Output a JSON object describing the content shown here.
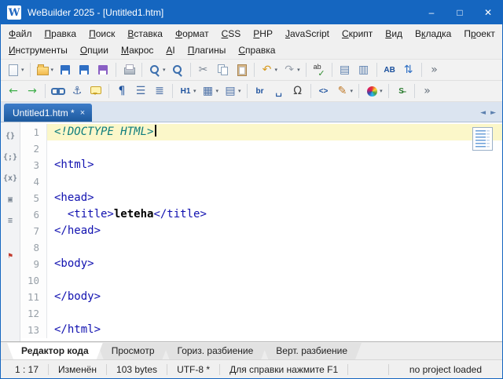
{
  "colors": {
    "titlebar": "#1566c0",
    "line_active": "#fbf7c9",
    "tag": "#1111b0",
    "doctype": "#0e7d7d"
  },
  "window": {
    "logo_letter": "W",
    "title": "WeBuilder 2025 - [Untitled1.htm]",
    "controls": {
      "minimize": "–",
      "maximize": "□",
      "close": "✕"
    }
  },
  "menu": {
    "row1": [
      {
        "label": "Файл",
        "accel": 0
      },
      {
        "label": "Правка",
        "accel": 0
      },
      {
        "label": "Поиск",
        "accel": 0
      },
      {
        "label": "Вставка",
        "accel": 0
      },
      {
        "label": "Формат",
        "accel": 0
      },
      {
        "label": "CSS",
        "accel": 0
      },
      {
        "label": "PHP",
        "accel": 0
      },
      {
        "label": "JavaScript",
        "accel": 0
      },
      {
        "label": "Скрипт",
        "accel": 0
      },
      {
        "label": "Вид",
        "accel": 0
      },
      {
        "label": "Вкладка",
        "accel": 1
      },
      {
        "label": "Проект",
        "accel": 1
      }
    ],
    "row2": [
      {
        "label": "Инструменты",
        "accel": 0
      },
      {
        "label": "Опции",
        "accel": 0
      },
      {
        "label": "Макрос",
        "accel": 0
      },
      {
        "label": "AI",
        "accel": 0
      },
      {
        "label": "Плагины",
        "accel": 0
      },
      {
        "label": "Справка",
        "accel": 0
      }
    ]
  },
  "toolbar": {
    "row1": [
      {
        "name": "new-file",
        "css": "file",
        "menu": true
      },
      {
        "sep": true
      },
      {
        "name": "open-file",
        "css": "folder",
        "menu": true
      },
      {
        "name": "save",
        "css": "save",
        "color": "#2f6fc4"
      },
      {
        "name": "save-all",
        "css": "save",
        "color": "#2f6fc4"
      },
      {
        "name": "save-as",
        "css": "save",
        "color": "#8a5fc4"
      },
      {
        "sep": true
      },
      {
        "name": "print",
        "css": "print"
      },
      {
        "sep": true
      },
      {
        "name": "find",
        "css": "search",
        "menu": true
      },
      {
        "name": "find-in-files",
        "css": "search"
      },
      {
        "sep": true
      },
      {
        "name": "cut",
        "glyph": "✂",
        "color": "#7a8694"
      },
      {
        "name": "copy",
        "css": "copy"
      },
      {
        "name": "paste",
        "css": "paste"
      },
      {
        "sep": true
      },
      {
        "name": "undo",
        "glyph": "↶",
        "color": "#d79a1e",
        "menu": true
      },
      {
        "name": "redo",
        "glyph": "↷",
        "color": "#9aa2ad",
        "menu": true
      },
      {
        "sep": true
      },
      {
        "name": "spell-check",
        "css": "spell"
      },
      {
        "sep": true
      },
      {
        "name": "code-explorer",
        "glyph": "▤",
        "color": "#5b7fae"
      },
      {
        "name": "split-view",
        "glyph": "▥",
        "color": "#5b7fae"
      },
      {
        "sep": true
      },
      {
        "name": "character-case",
        "text": "AB",
        "color": "#1a4f9c"
      },
      {
        "name": "sort-lines",
        "glyph": "⇅",
        "color": "#2f6fc4"
      },
      {
        "sep": true
      },
      {
        "name": "toolbar-overflow",
        "glyph": "»",
        "color": "#66707c"
      }
    ],
    "row2": [
      {
        "name": "navigate-back",
        "glyph": "←",
        "color": "#3fae4a"
      },
      {
        "name": "navigate-forward",
        "glyph": "→",
        "color": "#3fae4a"
      },
      {
        "sep": true
      },
      {
        "name": "hyperlink",
        "css": "link"
      },
      {
        "name": "anchor",
        "glyph": "⚓",
        "color": "#4a6fa5"
      },
      {
        "name": "comment",
        "css": "comment"
      },
      {
        "sep": true
      },
      {
        "name": "paragraph",
        "glyph": "¶",
        "color": "#1a4f9c"
      },
      {
        "name": "bullet-list",
        "glyph": "☰",
        "color": "#4a6fa5"
      },
      {
        "name": "numbered-list",
        "glyph": "≣",
        "color": "#4a6fa5"
      },
      {
        "sep": true
      },
      {
        "name": "heading",
        "text": "H1",
        "color": "#1a4f9c",
        "menu": true
      },
      {
        "name": "table",
        "glyph": "▦",
        "color": "#4a6fa5",
        "menu": true
      },
      {
        "name": "div-block",
        "glyph": "▤",
        "color": "#4a6fa5",
        "menu": true
      },
      {
        "sep": true
      },
      {
        "name": "line-break",
        "text": "br",
        "color": "#1a4f9c"
      },
      {
        "name": "non-breaking-space",
        "glyph": "␣",
        "color": "#1a4f9c"
      },
      {
        "name": "special-character",
        "glyph": "Ω",
        "color": "#444444"
      },
      {
        "sep": true
      },
      {
        "name": "insert-tag",
        "text": "<>",
        "color": "#1a4f9c"
      },
      {
        "name": "highlighter",
        "glyph": "✎",
        "color": "#c07a2a",
        "menu": true
      },
      {
        "sep": true
      },
      {
        "name": "color-picker",
        "css": "colorwheel",
        "menu": true
      },
      {
        "sep": true
      },
      {
        "name": "style-tool",
        "text": "S̶",
        "color": "#2e7d32"
      },
      {
        "sep": true
      },
      {
        "name": "toolbar-overflow",
        "glyph": "»",
        "color": "#66707c"
      }
    ]
  },
  "tabstrip": {
    "tabs": [
      {
        "label": "Untitled1.htm *",
        "close": "×",
        "active": true
      }
    ],
    "scroll_left": "◄",
    "scroll_right": "►"
  },
  "sidebar": {
    "icons": [
      {
        "name": "panel-code-snippets",
        "text": "{}"
      },
      {
        "name": "panel-code-inspector",
        "text": "{;}"
      },
      {
        "name": "panel-code-clips",
        "text": "{x}"
      },
      {
        "name": "panel-clipboard",
        "text": "▣"
      },
      {
        "name": "panel-file-explorer",
        "text": "≡"
      },
      {
        "name": "panel-validation",
        "text": "⚑",
        "color": "#c23b2e",
        "gap": true
      }
    ]
  },
  "editor": {
    "lines": [
      {
        "n": "1",
        "active": true,
        "caret": true,
        "segments": [
          {
            "text": "<!DOCTYPE HTML>",
            "type": "doctype"
          }
        ]
      },
      {
        "n": "2",
        "segments": []
      },
      {
        "n": "3",
        "segments": [
          {
            "text": "<html>",
            "type": "tag"
          }
        ]
      },
      {
        "n": "4",
        "segments": []
      },
      {
        "n": "5",
        "segments": [
          {
            "text": "<head>",
            "type": "tag"
          }
        ]
      },
      {
        "n": "6",
        "segments": [
          {
            "text": "  ",
            "type": "plain"
          },
          {
            "text": "<title>",
            "type": "tag"
          },
          {
            "text": "leteha",
            "type": "text"
          },
          {
            "text": "</title>",
            "type": "tag"
          }
        ]
      },
      {
        "n": "7",
        "segments": [
          {
            "text": "</head>",
            "type": "tag"
          }
        ]
      },
      {
        "n": "8",
        "segments": []
      },
      {
        "n": "9",
        "segments": [
          {
            "text": "<body>",
            "type": "tag"
          }
        ]
      },
      {
        "n": "10",
        "segments": []
      },
      {
        "n": "11",
        "segments": [
          {
            "text": "</body>",
            "type": "tag"
          }
        ]
      },
      {
        "n": "12",
        "segments": []
      },
      {
        "n": "13",
        "segments": [
          {
            "text": "</html>",
            "type": "tag"
          }
        ]
      }
    ]
  },
  "bottom_tabs": [
    {
      "label": "Редактор кода",
      "active": true
    },
    {
      "label": "Просмотр"
    },
    {
      "label": "Гориз. разбиение"
    },
    {
      "label": "Верт. разбиение"
    }
  ],
  "statusbar": {
    "cells": [
      "1 : 17",
      "Изменён",
      "103 bytes",
      "UTF-8 *",
      "Для справки нажмите F1"
    ],
    "right": "no project loaded"
  }
}
